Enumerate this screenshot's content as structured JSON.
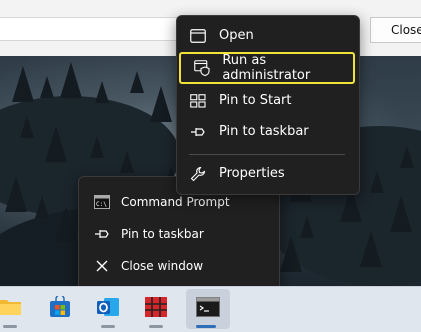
{
  "dialog": {
    "close_label": "Close"
  },
  "context_menu": {
    "items": [
      {
        "label": "Open",
        "icon": "window-icon"
      },
      {
        "label": "Run as administrator",
        "icon": "shield-icon",
        "highlighted": true
      },
      {
        "label": "Pin to Start",
        "icon": "pin-start-icon"
      },
      {
        "label": "Pin to taskbar",
        "icon": "pin-icon"
      },
      {
        "label": "Properties",
        "icon": "wrench-icon"
      }
    ],
    "highlight_color": "#f0e33a"
  },
  "jump_list": {
    "items": [
      {
        "label": "Command Prompt",
        "icon": "command-prompt-icon"
      },
      {
        "label": "Pin to taskbar",
        "icon": "pin-icon"
      },
      {
        "label": "Close window",
        "icon": "close-icon"
      }
    ]
  },
  "taskbar": {
    "apps": [
      {
        "name": "File Explorer",
        "icon": "folder-icon"
      },
      {
        "name": "Microsoft Store",
        "icon": "store-icon"
      },
      {
        "name": "Outlook",
        "icon": "outlook-icon"
      },
      {
        "name": "App",
        "icon": "red-grid-icon"
      },
      {
        "name": "Command Prompt",
        "icon": "command-prompt-icon",
        "active": true
      }
    ]
  }
}
